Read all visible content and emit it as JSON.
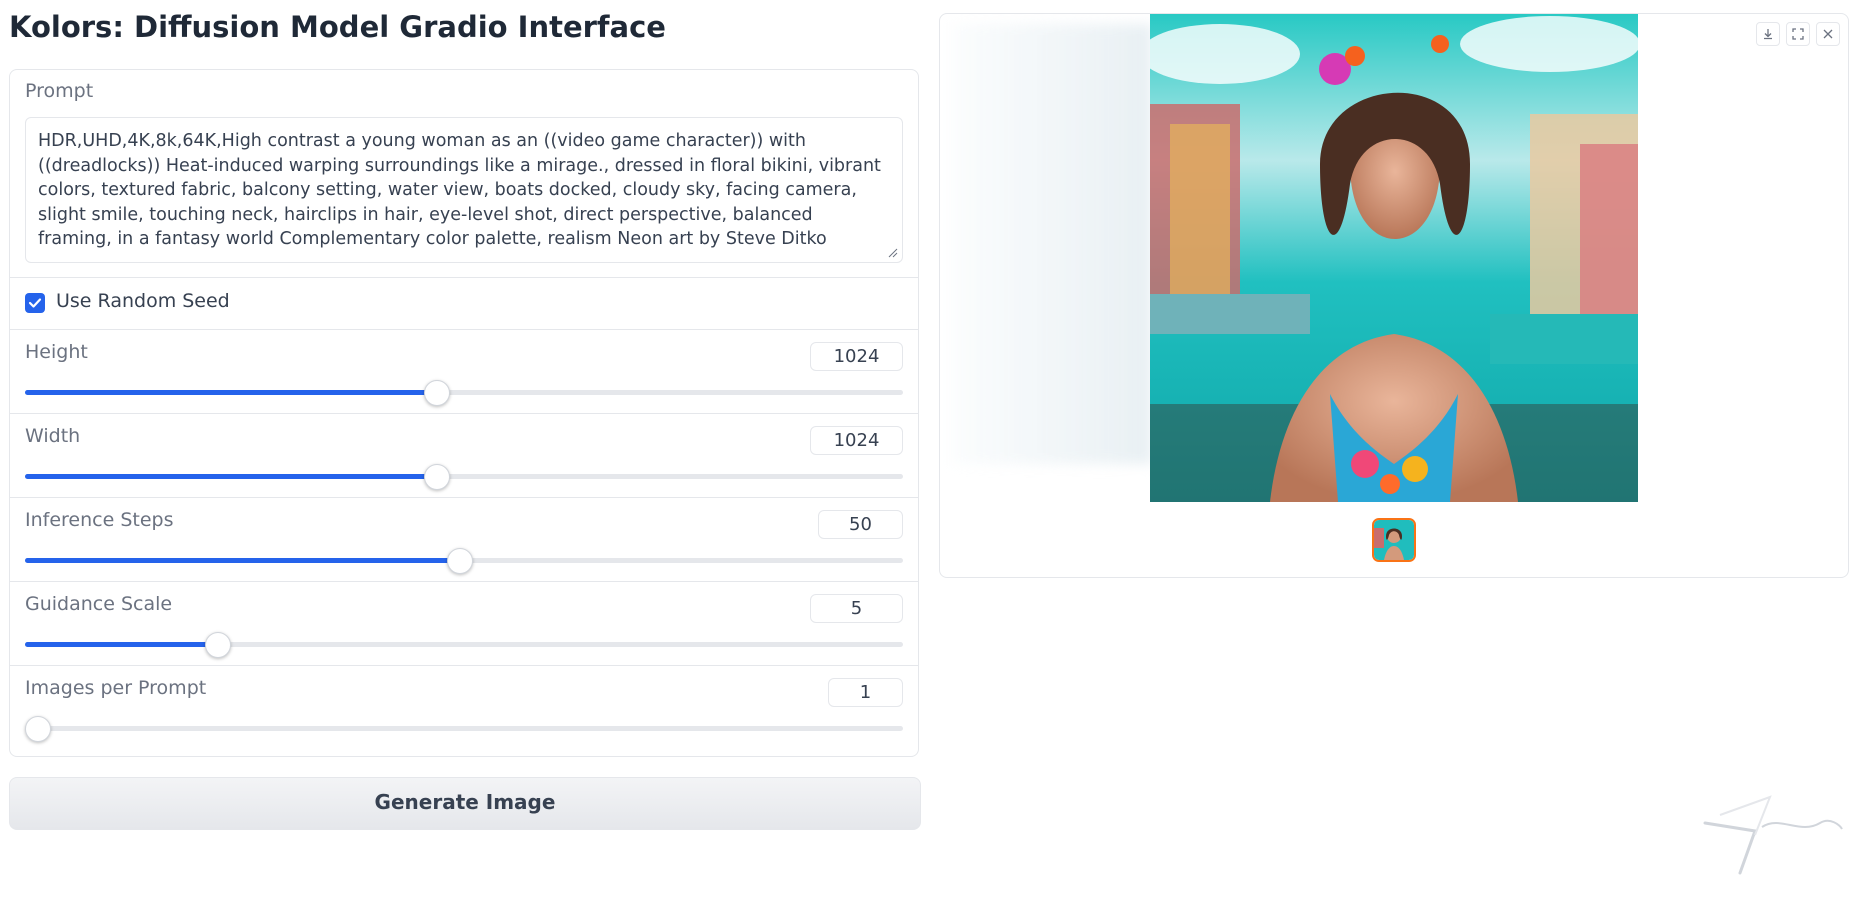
{
  "app": {
    "title": "Kolors: Diffusion Model Gradio Interface"
  },
  "prompt": {
    "label": "Prompt",
    "value": "HDR,UHD,4K,8k,64K,High contrast a young woman as an ((video game character)) with ((dreadlocks)) Heat-induced warping surroundings like a mirage., dressed in floral bikini, vibrant colors, textured fabric, balcony setting, water view, boats docked, cloudy sky, facing camera, slight smile, touching neck, hairclips in hair, eye-level shot, direct perspective, balanced framing, in a fantasy world Complementary color palette, realism Neon art by Steve Ditko"
  },
  "seed": {
    "label": "Use Random Seed",
    "checked": true
  },
  "sliders": {
    "height": {
      "label": "Height",
      "value": "1024",
      "fraction": 0.468
    },
    "width": {
      "label": "Width",
      "value": "1024",
      "fraction": 0.468
    },
    "steps": {
      "label": "Inference Steps",
      "value": "50",
      "fraction": 0.494
    },
    "guidance": {
      "label": "Guidance Scale",
      "value": "5",
      "fraction": 0.219
    },
    "images": {
      "label": "Images per Prompt",
      "value": "1",
      "fraction": 0.0
    }
  },
  "generate": {
    "label": "Generate Image"
  },
  "gallery": {
    "toolbar": [
      "download-icon",
      "fullscreen-icon",
      "close-icon"
    ]
  },
  "colors": {
    "accent": "#2563eb",
    "thumbnail_border": "#f97316"
  }
}
